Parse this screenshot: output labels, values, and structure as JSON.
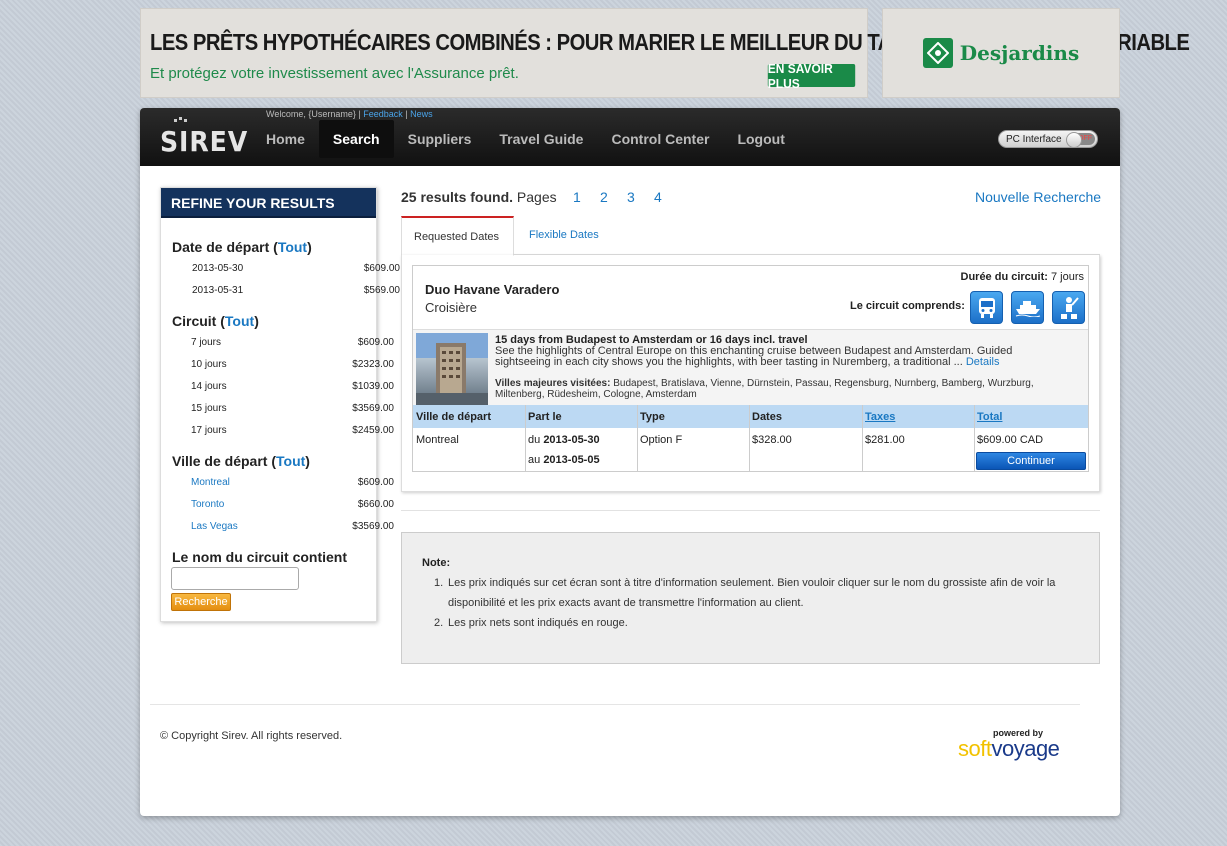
{
  "ads": {
    "headline": "LES PRÊTS HYPOTHÉCAIRES COMBINÉS : POUR MARIER LE MEILLEUR DU TAUX FIXE ET DU TAUX VARIABLE",
    "subline": "Et protégez votre investissement avec l'Assurance prêt.",
    "cta": "EN SAVOIR PLUS",
    "brand": "Desjardins"
  },
  "nav": {
    "logo": "SIREV",
    "welcome_prefix": "Welcome, {Username} |",
    "feedback": "Feedback",
    "sep": "|",
    "news": "News",
    "items": [
      "Home",
      "Search",
      "Suppliers",
      "Travel Guide",
      "Control Center",
      "Logout"
    ],
    "active": "Search",
    "pc_interface": "PC Interface",
    "toggle_state": "OFF"
  },
  "refine": {
    "title": "REFINE YOUR RESULTS",
    "all_label": "Tout",
    "dep_date": {
      "title": "Date de départ",
      "rows": [
        {
          "k": "2013-05-30",
          "v": "$609.00"
        },
        {
          "k": "2013-05-31",
          "v": "$569.00"
        }
      ]
    },
    "circuit": {
      "title": "Circuit",
      "rows": [
        {
          "k": "7 jours",
          "v": "$609.00"
        },
        {
          "k": "10 jours",
          "v": "$2323.00"
        },
        {
          "k": "14 jours",
          "v": "$1039.00"
        },
        {
          "k": "15 jours",
          "v": "$3569.00"
        },
        {
          "k": "17 jours",
          "v": "$2459.00"
        }
      ]
    },
    "city": {
      "title": "Ville de départ",
      "rows": [
        {
          "k": "Montreal",
          "v": "$609.00"
        },
        {
          "k": "Toronto",
          "v": "$660.00"
        },
        {
          "k": "Las Vegas",
          "v": "$3569.00"
        }
      ]
    },
    "name_filter": {
      "title": "Le nom du circuit contient",
      "value": "",
      "button": "Recherche"
    }
  },
  "results": {
    "count_text": "25 results found.",
    "pages_label": "Pages",
    "pages": [
      "1",
      "2",
      "3",
      "4"
    ],
    "new_search": "Nouvelle Recherche",
    "tabs": [
      "Requested Dates",
      "Flexible Dates"
    ]
  },
  "card": {
    "title": "Duo Havane Varadero",
    "subtitle": "Croisière",
    "duration_label": "Durée du circuit:",
    "duration_value": "7 jours",
    "includes_label": "Le circuit comprends:",
    "include_icons": [
      "bus-icon",
      "cruise-ship-icon",
      "activity-icon"
    ],
    "desc_title": "15 days from Budapest to Amsterdam or 16 days incl. travel",
    "desc_text": "See the highlights of Central Europe on this enchanting cruise between Budapest and Amsterdam. Guided sightseeing in each city shows you the highlights, with beer tasting in Nuremberg, a traditional ...",
    "details_link": "Details",
    "cities_label": "Villes majeures visitées:",
    "cities": "Budapest, Bratislava, Vienne, Dürnstein, Passau, Regensburg, Nurnberg, Bamberg, Wurzburg, Miltenberg, Rüdesheim, Cologne, Amsterdam",
    "columns": [
      "Ville de départ",
      "Part le",
      "Type",
      "Dates",
      "Taxes",
      "Total"
    ],
    "row": {
      "city": "Montreal",
      "du": "du",
      "from": "2013-05-30",
      "au": "au",
      "to": "2013-05-05",
      "type": "Option F",
      "dates": "$328.00",
      "taxes": "$281.00",
      "total": "$609.00 CAD",
      "continue": "Continuer"
    }
  },
  "note": {
    "title": "Note:",
    "items": [
      "Les prix indiqués sur cet écran sont à titre d'information seulement. Bien vouloir cliquer sur le nom du grossiste afin de voir la disponibilité et les prix exacts avant de transmettre l'information au client.",
      "Les prix nets sont indiqués en rouge."
    ]
  },
  "footer": {
    "copyright": "© Copyright Sirev.   All rights reserved.",
    "powered_by": "powered by",
    "brand_soft": "soft",
    "brand_voyage": "voyage"
  }
}
